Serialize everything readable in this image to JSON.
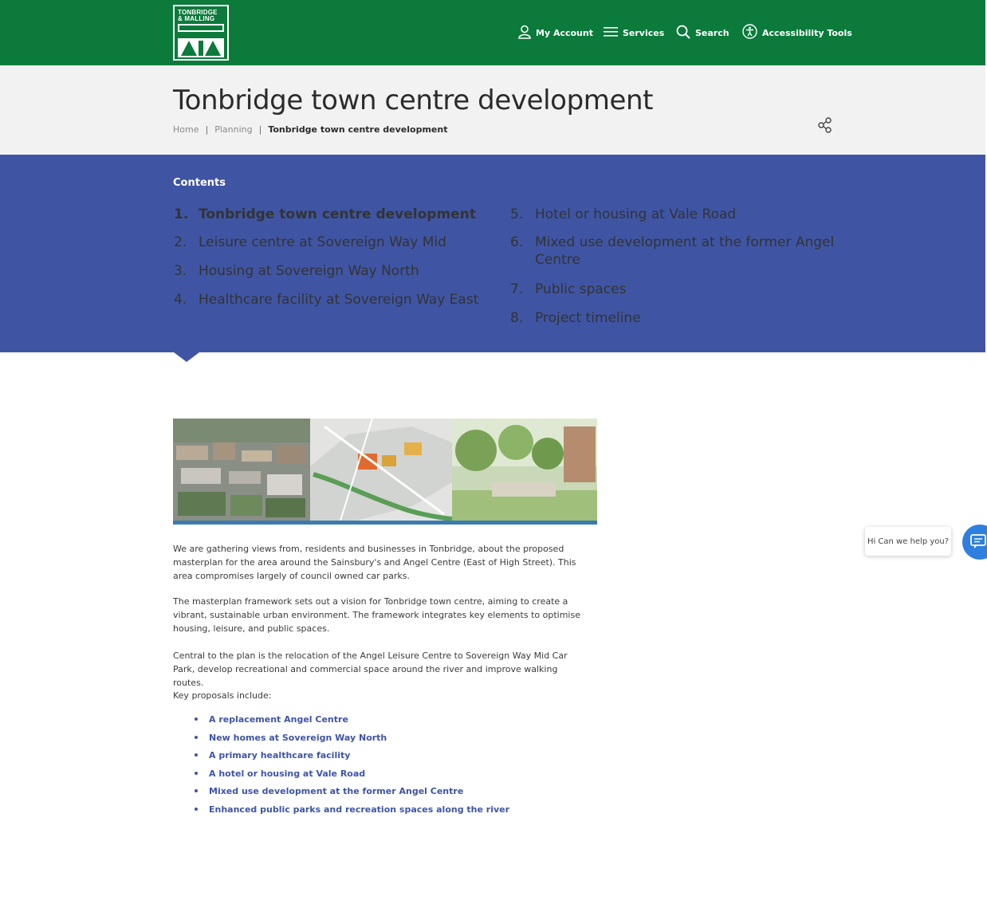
{
  "header": {
    "logo": {
      "line1": "TONBRIDGE",
      "line2": "& MALLING",
      "line3": "BOROUGH COUNCIL"
    },
    "nav": [
      {
        "label": "My Account",
        "icon": "user-icon"
      },
      {
        "label": "Services",
        "icon": "menu-icon"
      },
      {
        "label": "Search",
        "icon": "search-icon"
      },
      {
        "label": "Accessibility Tools",
        "icon": "accessibility-icon"
      }
    ],
    "colors": {
      "brand_green": "#0b7a3b"
    }
  },
  "page": {
    "title": "Tonbridge town centre development",
    "breadcrumb": [
      {
        "label": "Home"
      },
      {
        "label": "Planning"
      },
      {
        "label": "Tonbridge town centre development"
      }
    ],
    "share_icon": "share-icon"
  },
  "contents": {
    "heading": "Contents",
    "accent": "#3f55a4",
    "items": [
      {
        "num": "1.",
        "label": "Tonbridge town centre development",
        "active": true
      },
      {
        "num": "2.",
        "label": "Leisure centre at Sovereign Way Mid"
      },
      {
        "num": "3.",
        "label": "Housing at Sovereign Way North"
      },
      {
        "num": "4.",
        "label": "Healthcare facility at Sovereign Way East"
      },
      {
        "num": "5.",
        "label": "Hotel or housing at Vale Road"
      },
      {
        "num": "6.",
        "label": "Mixed use development at the former Angel",
        "label2": "Centre"
      },
      {
        "num": "7.",
        "label": "Public spaces"
      },
      {
        "num": "8.",
        "label": "Project timeline"
      }
    ]
  },
  "main": {
    "paragraphs": [
      "We are gathering views from, residents and businesses in Tonbridge, about the proposed masterplan for the area around the Sainsbury's and Angel Centre (East of High Street). This area compromises largely of council owned car parks.",
      "The masterplan framework sets out a vision for Tonbridge town centre, aiming to create a vibrant, sustainable urban environment. The framework integrates key elements to optimise housing, leisure, and public spaces.",
      "Central to the plan is the relocation of the Angel Leisure Centre to Sovereign Way Mid Car Park, develop recreational and commercial space around the river and improve walking routes.",
      "Key proposals include:"
    ],
    "proposals": [
      "A replacement Angel Centre",
      "New homes at Sovereign Way North",
      "A primary healthcare facility",
      "A hotel or housing at Vale Road",
      "Mixed use development at the former Angel Centre",
      "Enhanced public parks and recreation spaces along the river"
    ]
  },
  "chat": {
    "bubble_text": "Hi Can we help you?",
    "icon": "chat-icon",
    "color": "#2e7fe0"
  }
}
